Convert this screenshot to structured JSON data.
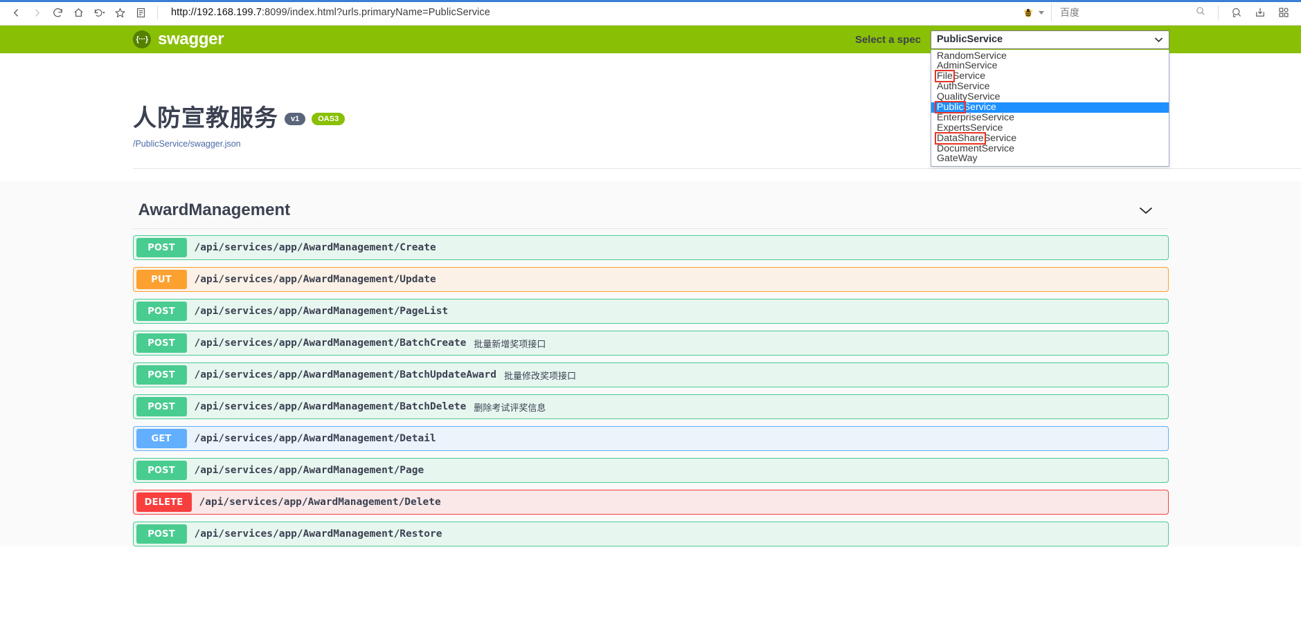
{
  "browser": {
    "url_host": "http://192.168.199.7",
    "url_rest": ":8099/index.html?urls.primaryName=PublicService",
    "back_icon": "back-arrow-icon",
    "forward_icon": "forward-arrow-icon",
    "reload_icon": "reload-icon",
    "home_icon": "home-icon",
    "history_icon": "history-icon",
    "bookmark_icon": "star-icon",
    "reader_icon": "reader-mode-icon",
    "search_engine_name": "百度",
    "search_placeholder": "",
    "search_icon": "search-icon",
    "screenshot_icon": "screenshot-icon",
    "download_icon": "download-icon",
    "apps_icon": "apps-grid-icon"
  },
  "topbar": {
    "logo_glyph": "{···}",
    "wordmark": "swagger",
    "select_label": "Select a spec",
    "selected_spec": "PublicService",
    "chevron_icon": "chevron-down-icon"
  },
  "spec_dropdown": {
    "open": true,
    "options": [
      {
        "label": "RandomService",
        "selected": false,
        "highlight": null
      },
      {
        "label": "AdminService",
        "selected": false,
        "highlight": null
      },
      {
        "label": "FileService",
        "selected": false,
        "highlight": "File"
      },
      {
        "label": "AuthService",
        "selected": false,
        "highlight": null
      },
      {
        "label": "QualityService",
        "selected": false,
        "highlight": null
      },
      {
        "label": "PublicService",
        "selected": true,
        "highlight": "Public"
      },
      {
        "label": "EnterpriseService",
        "selected": false,
        "highlight": null
      },
      {
        "label": "ExpertsService",
        "selected": false,
        "highlight": null
      },
      {
        "label": "DataShareService",
        "selected": false,
        "highlight": "DataShare"
      },
      {
        "label": "DocumentService",
        "selected": false,
        "highlight": null
      },
      {
        "label": "GateWay",
        "selected": false,
        "highlight": null
      }
    ],
    "highlight_color": "#e83323",
    "selected_color": "#1e90ff"
  },
  "info": {
    "title": "人防宣教服务",
    "version_badge": "v1",
    "oas_badge": "OAS3",
    "spec_link": "/PublicService/swagger.json"
  },
  "tag_section": {
    "name": "AwardManagement",
    "collapse_icon": "chevron-down-icon",
    "operations": [
      {
        "verb": "POST",
        "path": "/api/services/app/AwardManagement/Create",
        "description": ""
      },
      {
        "verb": "PUT",
        "path": "/api/services/app/AwardManagement/Update",
        "description": ""
      },
      {
        "verb": "POST",
        "path": "/api/services/app/AwardManagement/PageList",
        "description": ""
      },
      {
        "verb": "POST",
        "path": "/api/services/app/AwardManagement/BatchCreate",
        "description": "批量新增奖项接口"
      },
      {
        "verb": "POST",
        "path": "/api/services/app/AwardManagement/BatchUpdateAward",
        "description": "批量修改奖项接口"
      },
      {
        "verb": "POST",
        "path": "/api/services/app/AwardManagement/BatchDelete",
        "description": "删除考试评奖信息"
      },
      {
        "verb": "GET",
        "path": "/api/services/app/AwardManagement/Detail",
        "description": ""
      },
      {
        "verb": "POST",
        "path": "/api/services/app/AwardManagement/Page",
        "description": ""
      },
      {
        "verb": "DELETE",
        "path": "/api/services/app/AwardManagement/Delete",
        "description": ""
      },
      {
        "verb": "POST",
        "path": "/api/services/app/AwardManagement/Restore",
        "description": ""
      }
    ]
  },
  "colors": {
    "swagger_green": "#89bf04",
    "post": "#49cc90",
    "put": "#fca130",
    "get": "#61affe",
    "delete": "#f93e3e"
  }
}
